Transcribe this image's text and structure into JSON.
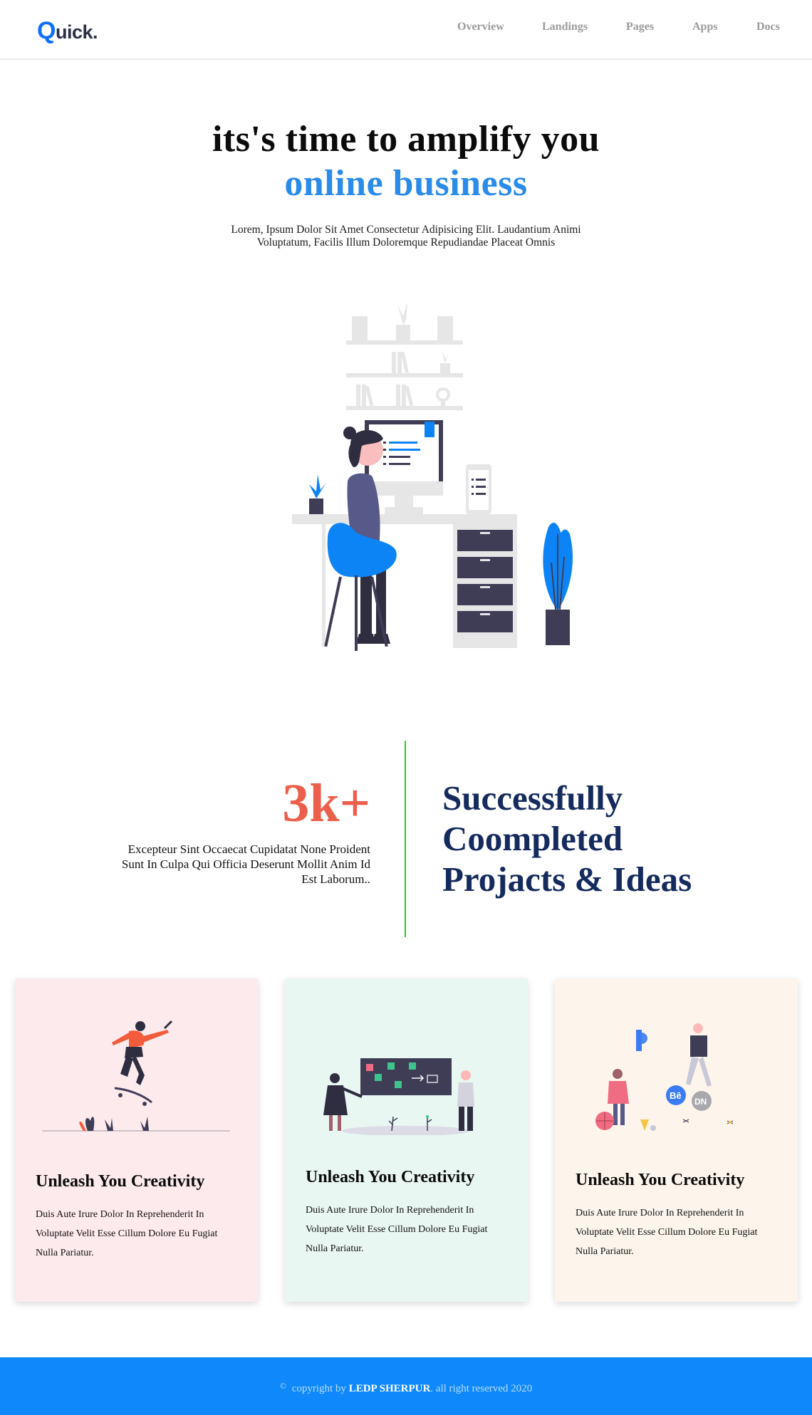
{
  "brand": {
    "logo_letter": "Q",
    "logo_rest": "uick."
  },
  "nav": {
    "items": [
      {
        "label": "Overview"
      },
      {
        "label": "Landings"
      },
      {
        "label": "Pages"
      },
      {
        "label": "Apps"
      },
      {
        "label": "Docs"
      }
    ]
  },
  "hero": {
    "title_line1": "its's time to amplify you",
    "title_line2": "online business",
    "subtitle_line1": "Lorem, Ipsum Dolor Sit Amet Consectetur Adipisicing Elit. Laudantium Animi",
    "subtitle_line2": "Voluptatum, Facilis Illum Doloremque Repudiandae Placeat Omnis",
    "illustration_icon": "person-at-desk-illustration"
  },
  "stats": {
    "number": "3k+",
    "description_line1": "Excepteur Sint Occaecat Cupidatat None Proident",
    "description_line2": "Sunt In Culpa Qui Officia Deserunt Mollit Anim Id",
    "description_line3": "Est Laborum..",
    "heading_line1": "Successfully",
    "heading_line2": "Coompleted",
    "heading_line3": "Projacts & Ideas"
  },
  "cards": [
    {
      "title": "Unleash You Creativity",
      "text_line1": "Duis Aute Irure Dolor In Reprehenderit In",
      "text_line2": "Voluptate Velit Esse Cillum Dolore Eu Fugiat",
      "text_line3": "Nulla Pariatur.",
      "background": "#fdeaed",
      "illustration_icon": "skateboarder-illustration"
    },
    {
      "title": "Unleash You Creativity",
      "text_line1": "Duis Aute Irure Dolor In Reprehenderit In",
      "text_line2": "Voluptate Velit Esse Cillum Dolore Eu Fugiat",
      "text_line3": "Nulla Pariatur.",
      "background": "#e9f7f2",
      "illustration_icon": "team-board-illustration"
    },
    {
      "title": "Unleash You Creativity",
      "text_line1": "Duis Aute Irure Dolor In Reprehenderit In",
      "text_line2": "Voluptate Velit Esse Cillum Dolore Eu Fugiat",
      "text_line3": "Nulla Pariatur.",
      "background": "#fdf5eb",
      "illustration_icon": "social-apps-illustration"
    }
  ],
  "footer": {
    "copyright_symbol": "©",
    "prefix": "copyright by",
    "company": "LEDP SHERPUR",
    "suffix": ". all right reserved 2020"
  },
  "colors": {
    "accent_blue": "#2b8be8",
    "stat_red": "#ec5f4c",
    "heading_navy": "#152b5e",
    "divider_green": "#2ecc2e",
    "footer_blue": "#0e88fb"
  }
}
